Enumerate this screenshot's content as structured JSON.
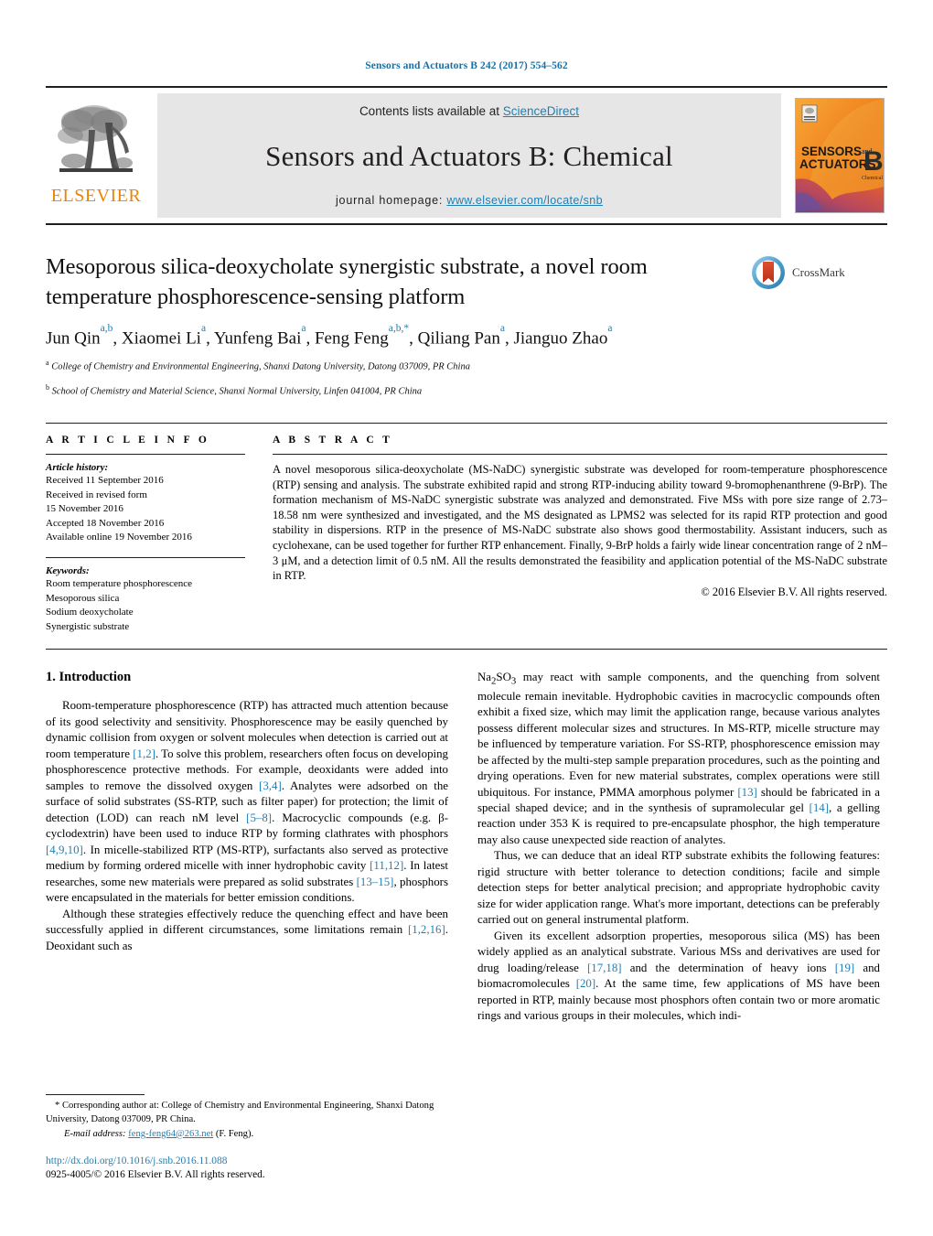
{
  "running_head": "Sensors and Actuators B 242 (2017) 554–562",
  "masthead": {
    "contents_prefix": "Contents lists available at ",
    "contents_link": "ScienceDirect",
    "journal_title": "Sensors and Actuators B: Chemical",
    "homepage_prefix": "journal homepage: ",
    "homepage_url": "www.elsevier.com/locate/snb",
    "publisher": "ELSEVIER",
    "cover_line1": "SENSORS",
    "cover_and": "and",
    "cover_line2": "ACTUATORS",
    "cover_letter": "B",
    "cover_sub": "Chemical"
  },
  "title": "Mesoporous silica-deoxycholate synergistic substrate, a novel room temperature phosphorescence-sensing platform",
  "crossmark_label": "CrossMark",
  "authors_html": "Jun Qin<sup>a,b</sup>, Xiaomei Li<sup>a</sup>, Yunfeng Bai<sup>a</sup>, Feng Feng<sup>a,b,</sup><sup>*</sup>, Qiliang Pan<sup>a</sup>, Jianguo Zhao<sup>a</sup>",
  "affiliations": [
    "a College of Chemistry and Environmental Engineering, Shanxi Datong University, Datong 037009, PR China",
    "b School of Chemistry and Material Science, Shanxi Normal University, Linfen 041004, PR China"
  ],
  "article_info": {
    "heading": "A R T I C L E   I N F O",
    "history_label": "Article history:",
    "history": [
      "Received 11 September 2016",
      "Received in revised form",
      "15 November 2016",
      "Accepted 18 November 2016",
      "Available online 19 November 2016"
    ],
    "keywords_label": "Keywords:",
    "keywords": [
      "Room temperature phosphorescence",
      "Mesoporous silica",
      "Sodium deoxycholate",
      "Synergistic substrate"
    ]
  },
  "abstract": {
    "heading": "A B S T R A C T",
    "text": "A novel mesoporous silica-deoxycholate (MS-NaDC) synergistic substrate was developed for room-temperature phosphorescence (RTP) sensing and analysis. The substrate exhibited rapid and strong RTP-inducing ability toward 9-bromophenanthrene (9-BrP). The formation mechanism of MS-NaDC synergistic substrate was analyzed and demonstrated. Five MSs with pore size range of 2.73–18.58 nm were synthesized and investigated, and the MS designated as LPMS2 was selected for its rapid RTP protection and good stability in dispersions. RTP in the presence of MS-NaDC substrate also shows good thermostability. Assistant inducers, such as cyclohexane, can be used together for further RTP enhancement. Finally, 9-BrP holds a fairly wide linear concentration range of 2 nM–3 μM, and a detection limit of 0.5 nM. All the results demonstrated the feasibility and application potential of the MS-NaDC substrate in RTP.",
    "copyright": "© 2016 Elsevier B.V. All rights reserved."
  },
  "introduction": {
    "section_number_title": "1.  Introduction",
    "left_paragraphs": [
      "Room-temperature phosphorescence (RTP) has attracted much attention because of its good selectivity and sensitivity. Phosphorescence may be easily quenched by dynamic collision from oxygen or solvent molecules when detection is carried out at room temperature [1,2]. To solve this problem, researchers often focus on developing phosphorescence protective methods. For example, deoxidants were added into samples to remove the dissolved oxygen [3,4]. Analytes were adsorbed on the surface of solid substrates (SS-RTP, such as filter paper) for protection; the limit of detection (LOD) can reach nM level [5–8]. Macrocyclic compounds (e.g. β-cyclodextrin) have been used to induce RTP by forming clathrates with phosphors [4,9,10]. In micelle-stabilized RTP (MS-RTP), surfactants also served as protective medium by forming ordered micelle with inner hydrophobic cavity [11,12]. In latest researches, some new materials were prepared as solid substrates [13–15], phosphors were encapsulated in the materials for better emission conditions.",
      "Although these strategies effectively reduce the quenching effect and have been successfully applied in different circumstances, some limitations remain [1,2,16]. Deoxidant such as"
    ],
    "right_paragraphs": [
      "Na2SO3 may react with sample components, and the quenching from solvent molecule remain inevitable. Hydrophobic cavities in macrocyclic compounds often exhibit a fixed size, which may limit the application range, because various analytes possess different molecular sizes and structures. In MS-RTP, micelle structure may be influenced by temperature variation. For SS-RTP, phosphorescence emission may be affected by the multi-step sample preparation procedures, such as the pointing and drying operations. Even for new material substrates, complex operations were still ubiquitous. For instance, PMMA amorphous polymer [13] should be fabricated in a special shaped device; and in the synthesis of supramolecular gel [14], a gelling reaction under 353 K is required to pre-encapsulate phosphor, the high temperature may also cause unexpected side reaction of analytes.",
      "Thus, we can deduce that an ideal RTP substrate exhibits the following features: rigid structure with better tolerance to detection conditions; facile and simple detection steps for better analytical precision; and appropriate hydrophobic cavity size for wider application range. What's more important, detections can be preferably carried out on general instrumental platform.",
      "Given its excellent adsorption properties, mesoporous silica (MS) has been widely applied as an analytical substrate. Various MSs and derivatives are used for drug loading/release [17,18] and the determination of heavy ions [19] and biomacromolecules [20]. At the same time, few applications of MS have been reported in RTP, mainly because most phosphors often contain two or more aromatic rings and various groups in their molecules, which indi-"
    ]
  },
  "footnote": {
    "corresponding": "* Corresponding author at: College of Chemistry and Environmental Engineering, Shanxi Datong University, Datong 037009, PR China.",
    "email_label": "E-mail address:",
    "email": "feng-feng64@263.net",
    "email_suffix": "(F. Feng).",
    "doi": "http://dx.doi.org/10.1016/j.snb.2016.11.088",
    "issn": "0925-4005/© 2016 Elsevier B.V. All rights reserved."
  },
  "colors": {
    "link": "#1f7fb5",
    "elsevier_orange": "#ef8200",
    "crossmark_blue": "#4a9fd0",
    "crossmark_red": "#d0412a"
  }
}
